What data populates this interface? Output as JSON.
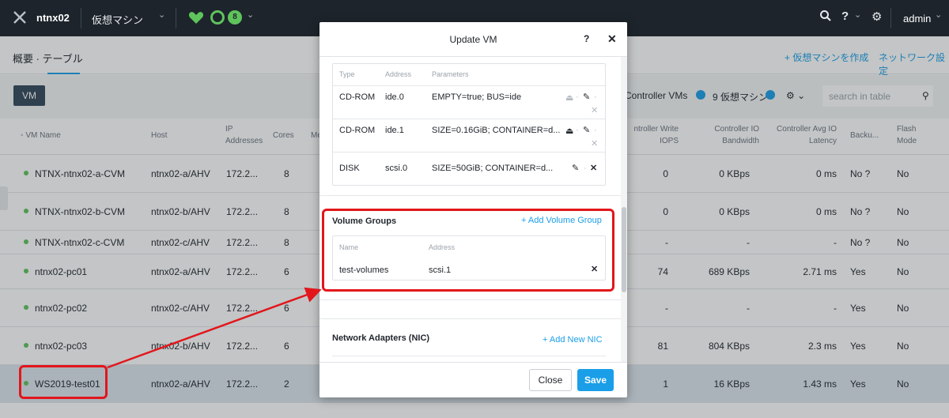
{
  "topbar": {
    "cluster": "ntnx02",
    "context": "仮想マシン",
    "alert_count": "8",
    "admin": "admin"
  },
  "subnav": {
    "crumb": "概要 · テーブル",
    "create": "+ 仮想マシンを作成",
    "network": "ネットワーク設定"
  },
  "toolbar": {
    "vm_tab": "VM",
    "controller_vms": "Controller VMs",
    "vm_count": "9 仮想マシン",
    "search_placeholder": "search in table"
  },
  "table": {
    "headers": {
      "name": "VM Name",
      "host": "Host",
      "ip": "IP Addresses",
      "cores": "Cores",
      "mem": "Me",
      "ctrl_write": "ntroller Write IOPS",
      "ctrl_io": "Controller IO Bandwidth",
      "ctrl_lat": "Controller Avg IO Latency",
      "backup": "Backu...",
      "flash": "Flash Mode"
    },
    "rows": [
      {
        "name": "NTNX-ntnx02-a-CVM",
        "host": "ntnx02-a/AHV",
        "ip": "172.2...",
        "cores": "8",
        "iops": "0",
        "bw": "0 KBps",
        "lat": "0 ms",
        "backup": "No ?",
        "flash": "No"
      },
      {
        "name": "NTNX-ntnx02-b-CVM",
        "host": "ntnx02-b/AHV",
        "ip": "172.2...",
        "cores": "8",
        "iops": "0",
        "bw": "0 KBps",
        "lat": "0 ms",
        "backup": "No ?",
        "flash": "No"
      },
      {
        "name": "NTNX-ntnx02-c-CVM",
        "host": "ntnx02-c/AHV",
        "ip": "172.2...",
        "cores": "8",
        "iops": "-",
        "bw": "-",
        "lat": "-",
        "backup": "No ?",
        "flash": "No"
      },
      {
        "name": "ntnx02-pc01",
        "host": "ntnx02-a/AHV",
        "ip": "172.2...",
        "cores": "6",
        "iops": "74",
        "bw": "689 KBps",
        "lat": "2.71 ms",
        "backup": "Yes",
        "flash": "No"
      },
      {
        "name": "ntnx02-pc02",
        "host": "ntnx02-c/AHV",
        "ip": "172.2...",
        "cores": "6",
        "iops": "-",
        "bw": "-",
        "lat": "-",
        "backup": "Yes",
        "flash": "No"
      },
      {
        "name": "ntnx02-pc03",
        "host": "ntnx02-b/AHV",
        "ip": "172.2...",
        "cores": "6",
        "iops": "81",
        "bw": "804 KBps",
        "lat": "2.3 ms",
        "backup": "Yes",
        "flash": "No"
      },
      {
        "name": "WS2019-test01",
        "host": "ntnx02-a/AHV",
        "ip": "172.2...",
        "cores": "2",
        "iops": "1",
        "bw": "16 KBps",
        "lat": "1.43 ms",
        "backup": "Yes",
        "flash": "No"
      }
    ]
  },
  "modal": {
    "title": "Update VM",
    "help": "?",
    "disks": {
      "headers": {
        "type": "Type",
        "address": "Address",
        "params": "Parameters"
      },
      "rows": [
        {
          "type": "CD-ROM",
          "address": "ide.0",
          "params": "EMPTY=true; BUS=ide"
        },
        {
          "type": "CD-ROM",
          "address": "ide.1",
          "params": "SIZE=0.16GiB; CONTAINER=d..."
        },
        {
          "type": "DISK",
          "address": "scsi.0",
          "params": "SIZE=50GiB; CONTAINER=d..."
        }
      ]
    },
    "volume_groups": {
      "title": "Volume Groups",
      "add": "+ Add Volume Group",
      "headers": {
        "name": "Name",
        "address": "Address"
      },
      "row": {
        "name": "test-volumes",
        "address": "scsi.1"
      }
    },
    "nic": {
      "title": "Network Adapters (NIC)",
      "add": "+ Add New NIC"
    },
    "close": "Close",
    "save": "Save"
  },
  "colors": {
    "accent": "#1a9ee8",
    "highlight": "#e2161b",
    "status_ok": "#5fc35c",
    "topbar": "#1d242b"
  }
}
